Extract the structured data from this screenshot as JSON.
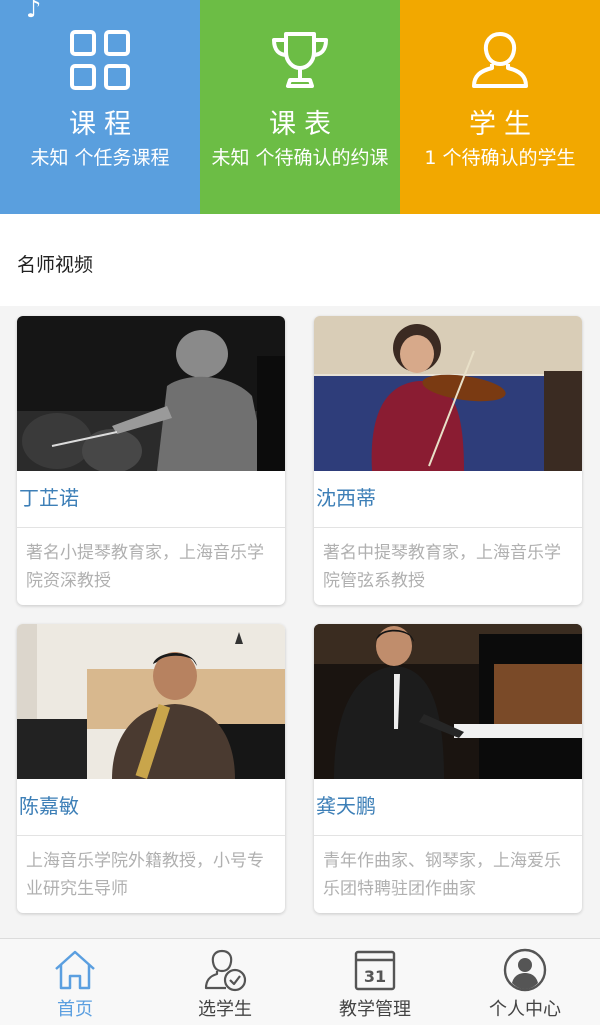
{
  "colors": {
    "course": "#5a9fde",
    "schedule": "#6cbd45",
    "student": "#f2a800",
    "link": "#3d7fb7",
    "active": "#5b9fe0"
  },
  "tiles": [
    {
      "title": "课程",
      "subtitle": "未知 个任务课程",
      "icon": "grid-icon"
    },
    {
      "title": "课表",
      "subtitle": "未知 个待确认的约课",
      "icon": "trophy-icon"
    },
    {
      "title": "学生",
      "subtitle": "1 个待确认的学生",
      "icon": "user-icon"
    }
  ],
  "section": {
    "title": "名师视频"
  },
  "teachers": [
    {
      "name": "丁芷诺",
      "desc": "著名小提琴教育家，上海音乐学院资深教授"
    },
    {
      "name": "沈西蒂",
      "desc": "著名中提琴教育家，上海音乐学院管弦系教授"
    },
    {
      "name": "陈嘉敏",
      "desc": "上海音乐学院外籍教授，小号专业研究生导师"
    },
    {
      "name": "龚天鹏",
      "desc": "青年作曲家、钢琴家，上海爱乐乐团特聘驻团作曲家"
    }
  ],
  "tabbar": {
    "items": [
      {
        "label": "首页",
        "icon": "home-icon",
        "active": true
      },
      {
        "label": "选学生",
        "icon": "select-student-icon",
        "active": false
      },
      {
        "label": "教学管理",
        "icon": "calendar-icon",
        "active": false,
        "badge": "31"
      },
      {
        "label": "个人中心",
        "icon": "profile-icon",
        "active": false
      }
    ]
  }
}
